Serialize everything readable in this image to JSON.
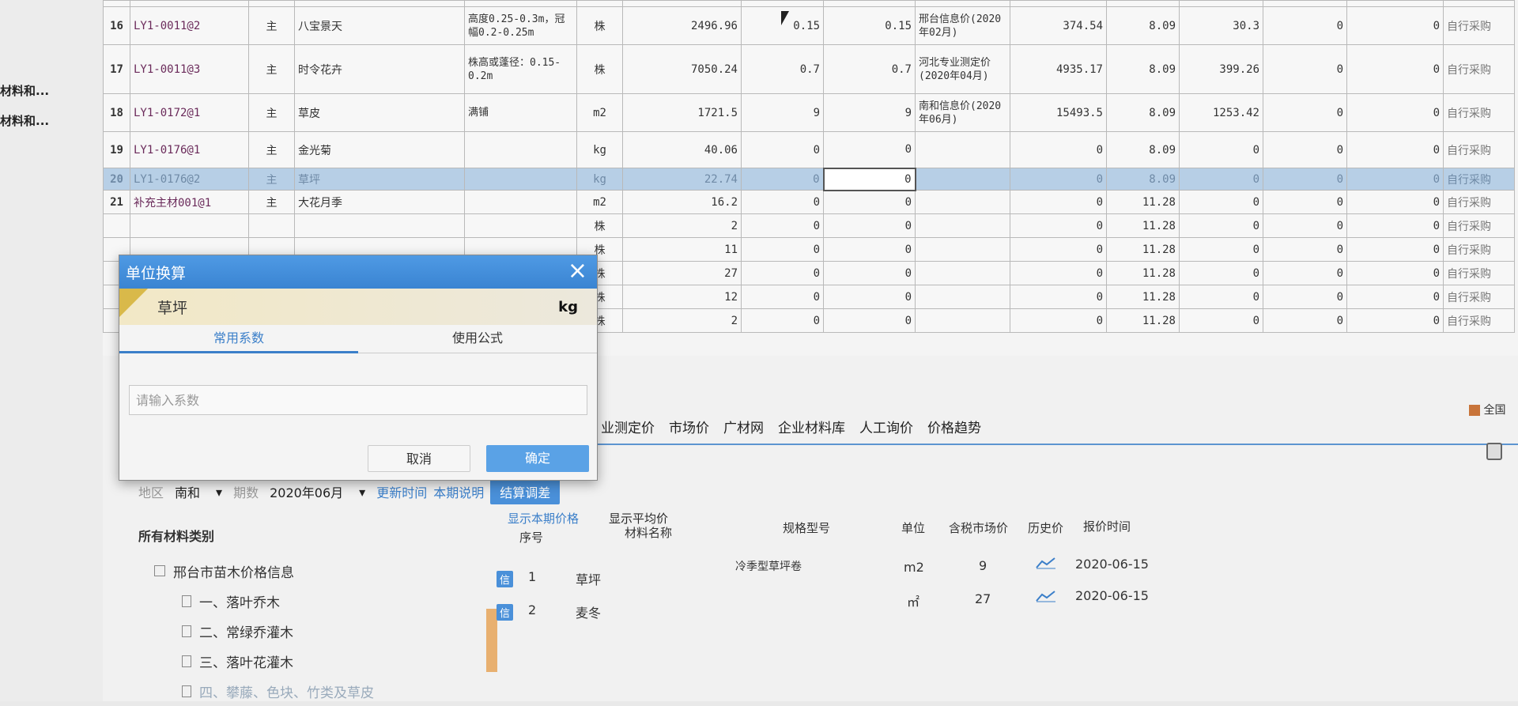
{
  "left_labels": [
    "材料和...",
    "材料和..."
  ],
  "grid_rows": [
    {
      "no": "16",
      "code": "LY1-0011@2",
      "type": "主",
      "name": "八宝景天",
      "spec": "高度0.25-0.3m，冠幅0.2-0.25m",
      "unit": "株",
      "qty": "2496.96",
      "c1": "0.15",
      "c2": "0.15",
      "src": "邢台信息价(2020年02月)",
      "v1": "374.54",
      "v2": "8.09",
      "v3": "30.3",
      "v4": "0",
      "v5": "0",
      "mode": "自行采购"
    },
    {
      "no": "17",
      "code": "LY1-0011@3",
      "type": "主",
      "name": "时令花卉",
      "spec": "株高或蓬径：0.15-0.2m",
      "unit": "株",
      "qty": "7050.24",
      "c1": "0.7",
      "c2": "0.7",
      "src": "河北专业测定价(2020年04月)",
      "v1": "4935.17",
      "v2": "8.09",
      "v3": "399.26",
      "v4": "0",
      "v5": "0",
      "mode": "自行采购"
    },
    {
      "no": "18",
      "code": "LY1-0172@1",
      "type": "主",
      "name": "草皮",
      "spec": "满铺",
      "unit": "m2",
      "qty": "1721.5",
      "c1": "9",
      "c2": "9",
      "src": "南和信息价(2020年06月)",
      "v1": "15493.5",
      "v2": "8.09",
      "v3": "1253.42",
      "v4": "0",
      "v5": "0",
      "mode": "自行采购"
    },
    {
      "no": "19",
      "code": "LY1-0176@1",
      "type": "主",
      "name": "金光菊",
      "spec": "",
      "unit": "kg",
      "qty": "40.06",
      "c1": "0",
      "c2": "0",
      "src": "",
      "v1": "0",
      "v2": "8.09",
      "v3": "0",
      "v4": "0",
      "v5": "0",
      "mode": "自行采购"
    },
    {
      "no": "20",
      "code": "LY1-0176@2",
      "type": "主",
      "name": "草坪",
      "spec": "",
      "unit": "kg",
      "qty": "22.74",
      "c1": "0",
      "c2": "0",
      "src": "",
      "v1": "0",
      "v2": "8.09",
      "v3": "0",
      "v4": "0",
      "v5": "0",
      "mode": "自行采购"
    },
    {
      "no": "21",
      "code": "补充主材001@1",
      "type": "主",
      "name": "大花月季",
      "spec": "",
      "unit": "m2",
      "qty": "16.2",
      "c1": "0",
      "c2": "0",
      "src": "",
      "v1": "0",
      "v2": "11.28",
      "v3": "0",
      "v4": "0",
      "v5": "0",
      "mode": "自行采购"
    },
    {
      "no": "",
      "code": "",
      "type": "",
      "name": "",
      "spec": "",
      "unit": "株",
      "qty": "2",
      "c1": "0",
      "c2": "0",
      "src": "",
      "v1": "0",
      "v2": "11.28",
      "v3": "0",
      "v4": "0",
      "v5": "0",
      "mode": "自行采购"
    },
    {
      "no": "",
      "code": "",
      "type": "",
      "name": "",
      "spec": "",
      "unit": "株",
      "qty": "11",
      "c1": "0",
      "c2": "0",
      "src": "",
      "v1": "0",
      "v2": "11.28",
      "v3": "0",
      "v4": "0",
      "v5": "0",
      "mode": "自行采购"
    },
    {
      "no": "",
      "code": "",
      "type": "",
      "name": "",
      "spec": "",
      "unit": "株",
      "qty": "27",
      "c1": "0",
      "c2": "0",
      "src": "",
      "v1": "0",
      "v2": "11.28",
      "v3": "0",
      "v4": "0",
      "v5": "0",
      "mode": "自行采购"
    },
    {
      "no": "",
      "code": "",
      "type": "",
      "name": "",
      "spec": "",
      "unit": "株",
      "qty": "12",
      "c1": "0",
      "c2": "0",
      "src": "",
      "v1": "0",
      "v2": "11.28",
      "v3": "0",
      "v4": "0",
      "v5": "0",
      "mode": "自行采购"
    },
    {
      "no": "",
      "code": "",
      "type": "",
      "name": "",
      "spec": "",
      "unit": "株",
      "qty": "2",
      "c1": "0",
      "c2": "0",
      "src": "",
      "v1": "0",
      "v2": "11.28",
      "v3": "0",
      "v4": "0",
      "v5": "0",
      "mode": "自行采购"
    }
  ],
  "tabs": [
    "业测定价",
    "市场价",
    "广材网",
    "企业材料库",
    "人工询价",
    "价格趋势"
  ],
  "right_icon_label": "全国",
  "filter": {
    "region_label": "地区",
    "region": "南和",
    "period_label": "期数",
    "period": "2020年06月",
    "update_time": "更新时间",
    "period_note": "本期说明",
    "settle_button": "结算调差"
  },
  "tree": {
    "header": "所有材料类别",
    "root": "邢台市苗木价格信息",
    "children": [
      "一、落叶乔木",
      "二、常绿乔灌木",
      "三、落叶花灌木",
      "四、攀藤、色块、竹类及草皮"
    ]
  },
  "price_panel": {
    "tabs": [
      "显示本期价格",
      "显示平均价"
    ],
    "headers": {
      "no": "序号",
      "name": "材料名称",
      "spec": "规格型号",
      "unit": "单位",
      "price": "含税市场价",
      "history": "历史价",
      "time": "报价时间"
    },
    "rows": [
      {
        "badge": "信",
        "no": "1",
        "name": "草坪",
        "spec": "冷季型草坪卷",
        "unit": "m2",
        "price": "9",
        "time": "2020-06-15"
      },
      {
        "badge": "信",
        "no": "2",
        "name": "麦冬",
        "spec": "",
        "unit": "㎡",
        "price": "27",
        "time": "2020-06-15"
      }
    ]
  },
  "dialog": {
    "title": "单位换算",
    "close": "×",
    "material": "草坪",
    "unit": "kg",
    "tab_common": "常用系数",
    "tab_formula": "使用公式",
    "input_placeholder": "请输入系数",
    "cancel": "取消",
    "ok": "确定"
  }
}
